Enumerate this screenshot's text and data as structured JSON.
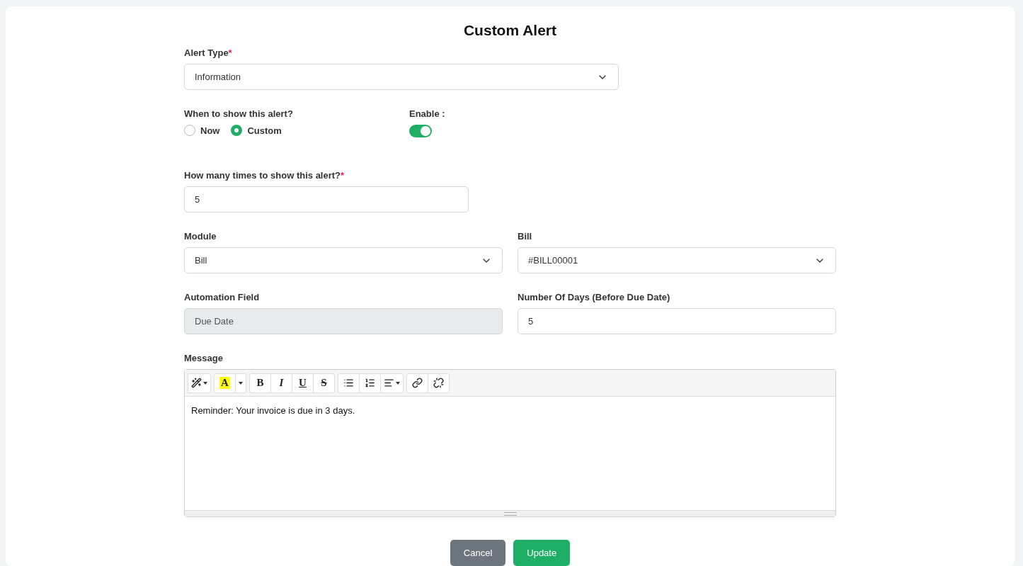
{
  "title": "Custom Alert",
  "alert_type": {
    "label": "Alert Type",
    "required_mark": "*",
    "value": "Information"
  },
  "when": {
    "label": "When to show this alert?",
    "options": [
      {
        "label": "Now",
        "selected": false
      },
      {
        "label": "Custom",
        "selected": true
      }
    ]
  },
  "enable": {
    "label": "Enable :",
    "on": true
  },
  "times": {
    "label": "How many times to show this alert?",
    "required_mark": "*",
    "value": "5"
  },
  "rows": [
    [
      {
        "kind": "select",
        "label": "Module",
        "value": "Bill"
      },
      {
        "kind": "select",
        "label": "Bill",
        "value": "#BILL00001"
      }
    ],
    [
      {
        "kind": "input",
        "label": "Automation Field",
        "value": "Due Date",
        "disabled": true
      },
      {
        "kind": "input",
        "label": "Number Of Days (Before Due Date)",
        "value": "5",
        "disabled": false
      }
    ]
  ],
  "message": {
    "label": "Message",
    "text": "Reminder: Your invoice is due in 3 days.",
    "toolbar": [
      [
        {
          "kind": "magic"
        }
      ],
      [
        {
          "kind": "highlight",
          "label": "A"
        },
        {
          "kind": "caret"
        }
      ],
      [
        {
          "kind": "bold",
          "label": "B"
        },
        {
          "kind": "italic",
          "label": "I"
        },
        {
          "kind": "underline",
          "label": "U"
        },
        {
          "kind": "strike",
          "label": "S"
        }
      ],
      [
        {
          "kind": "bullets"
        },
        {
          "kind": "numbers"
        },
        {
          "kind": "align"
        }
      ],
      [
        {
          "kind": "link"
        },
        {
          "kind": "unlink"
        }
      ]
    ]
  },
  "buttons": [
    {
      "kind": "secondary",
      "label": "Cancel"
    },
    {
      "kind": "primary",
      "label": "Update"
    }
  ]
}
